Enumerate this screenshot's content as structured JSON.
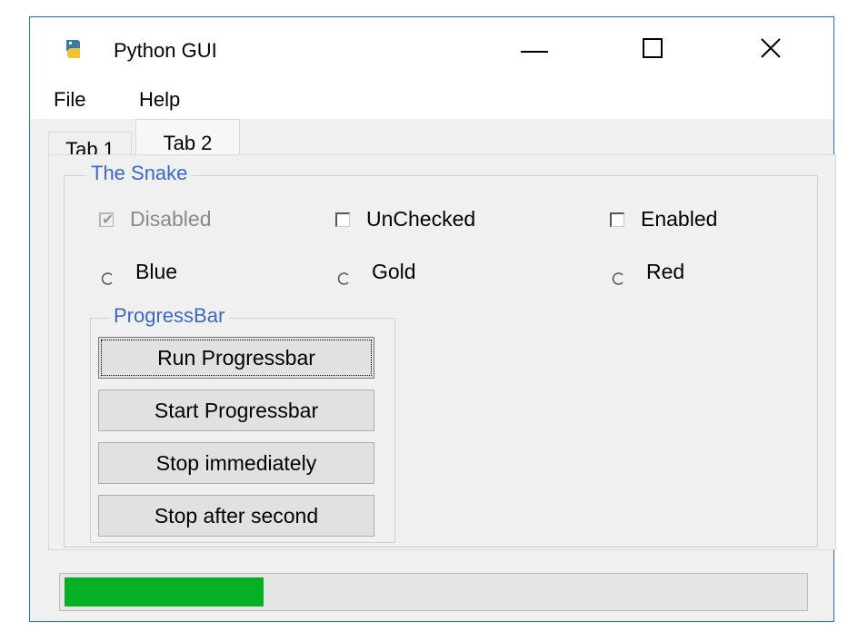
{
  "window": {
    "title": "Python GUI",
    "controls": {
      "minimize_icon": "minimize-icon",
      "maximize_icon": "maximize-icon",
      "close_icon": "close-icon"
    }
  },
  "menu": {
    "items": [
      "File",
      "Help"
    ]
  },
  "tabs": [
    {
      "label": "Tab 1",
      "selected": false
    },
    {
      "label": "Tab 2",
      "selected": true
    }
  ],
  "snake_group": {
    "title": "The Snake",
    "checkboxes": [
      {
        "label": "Disabled",
        "checked": true,
        "enabled": false
      },
      {
        "label": "UnChecked",
        "checked": false,
        "enabled": true
      },
      {
        "label": "Enabled",
        "checked": false,
        "enabled": true
      }
    ],
    "radios": [
      {
        "label": "Blue",
        "selected": false
      },
      {
        "label": "Gold",
        "selected": false
      },
      {
        "label": "Red",
        "selected": false
      }
    ]
  },
  "progress_group": {
    "title": "ProgressBar",
    "buttons": [
      "Run Progressbar",
      "Start Progressbar",
      "Stop immediately",
      "Stop after second"
    ]
  },
  "progressbar": {
    "value_fraction": 0.27,
    "color": "#06b025"
  },
  "colors": {
    "accent": "#3a67c8",
    "window_border": "#2b6fb6"
  }
}
